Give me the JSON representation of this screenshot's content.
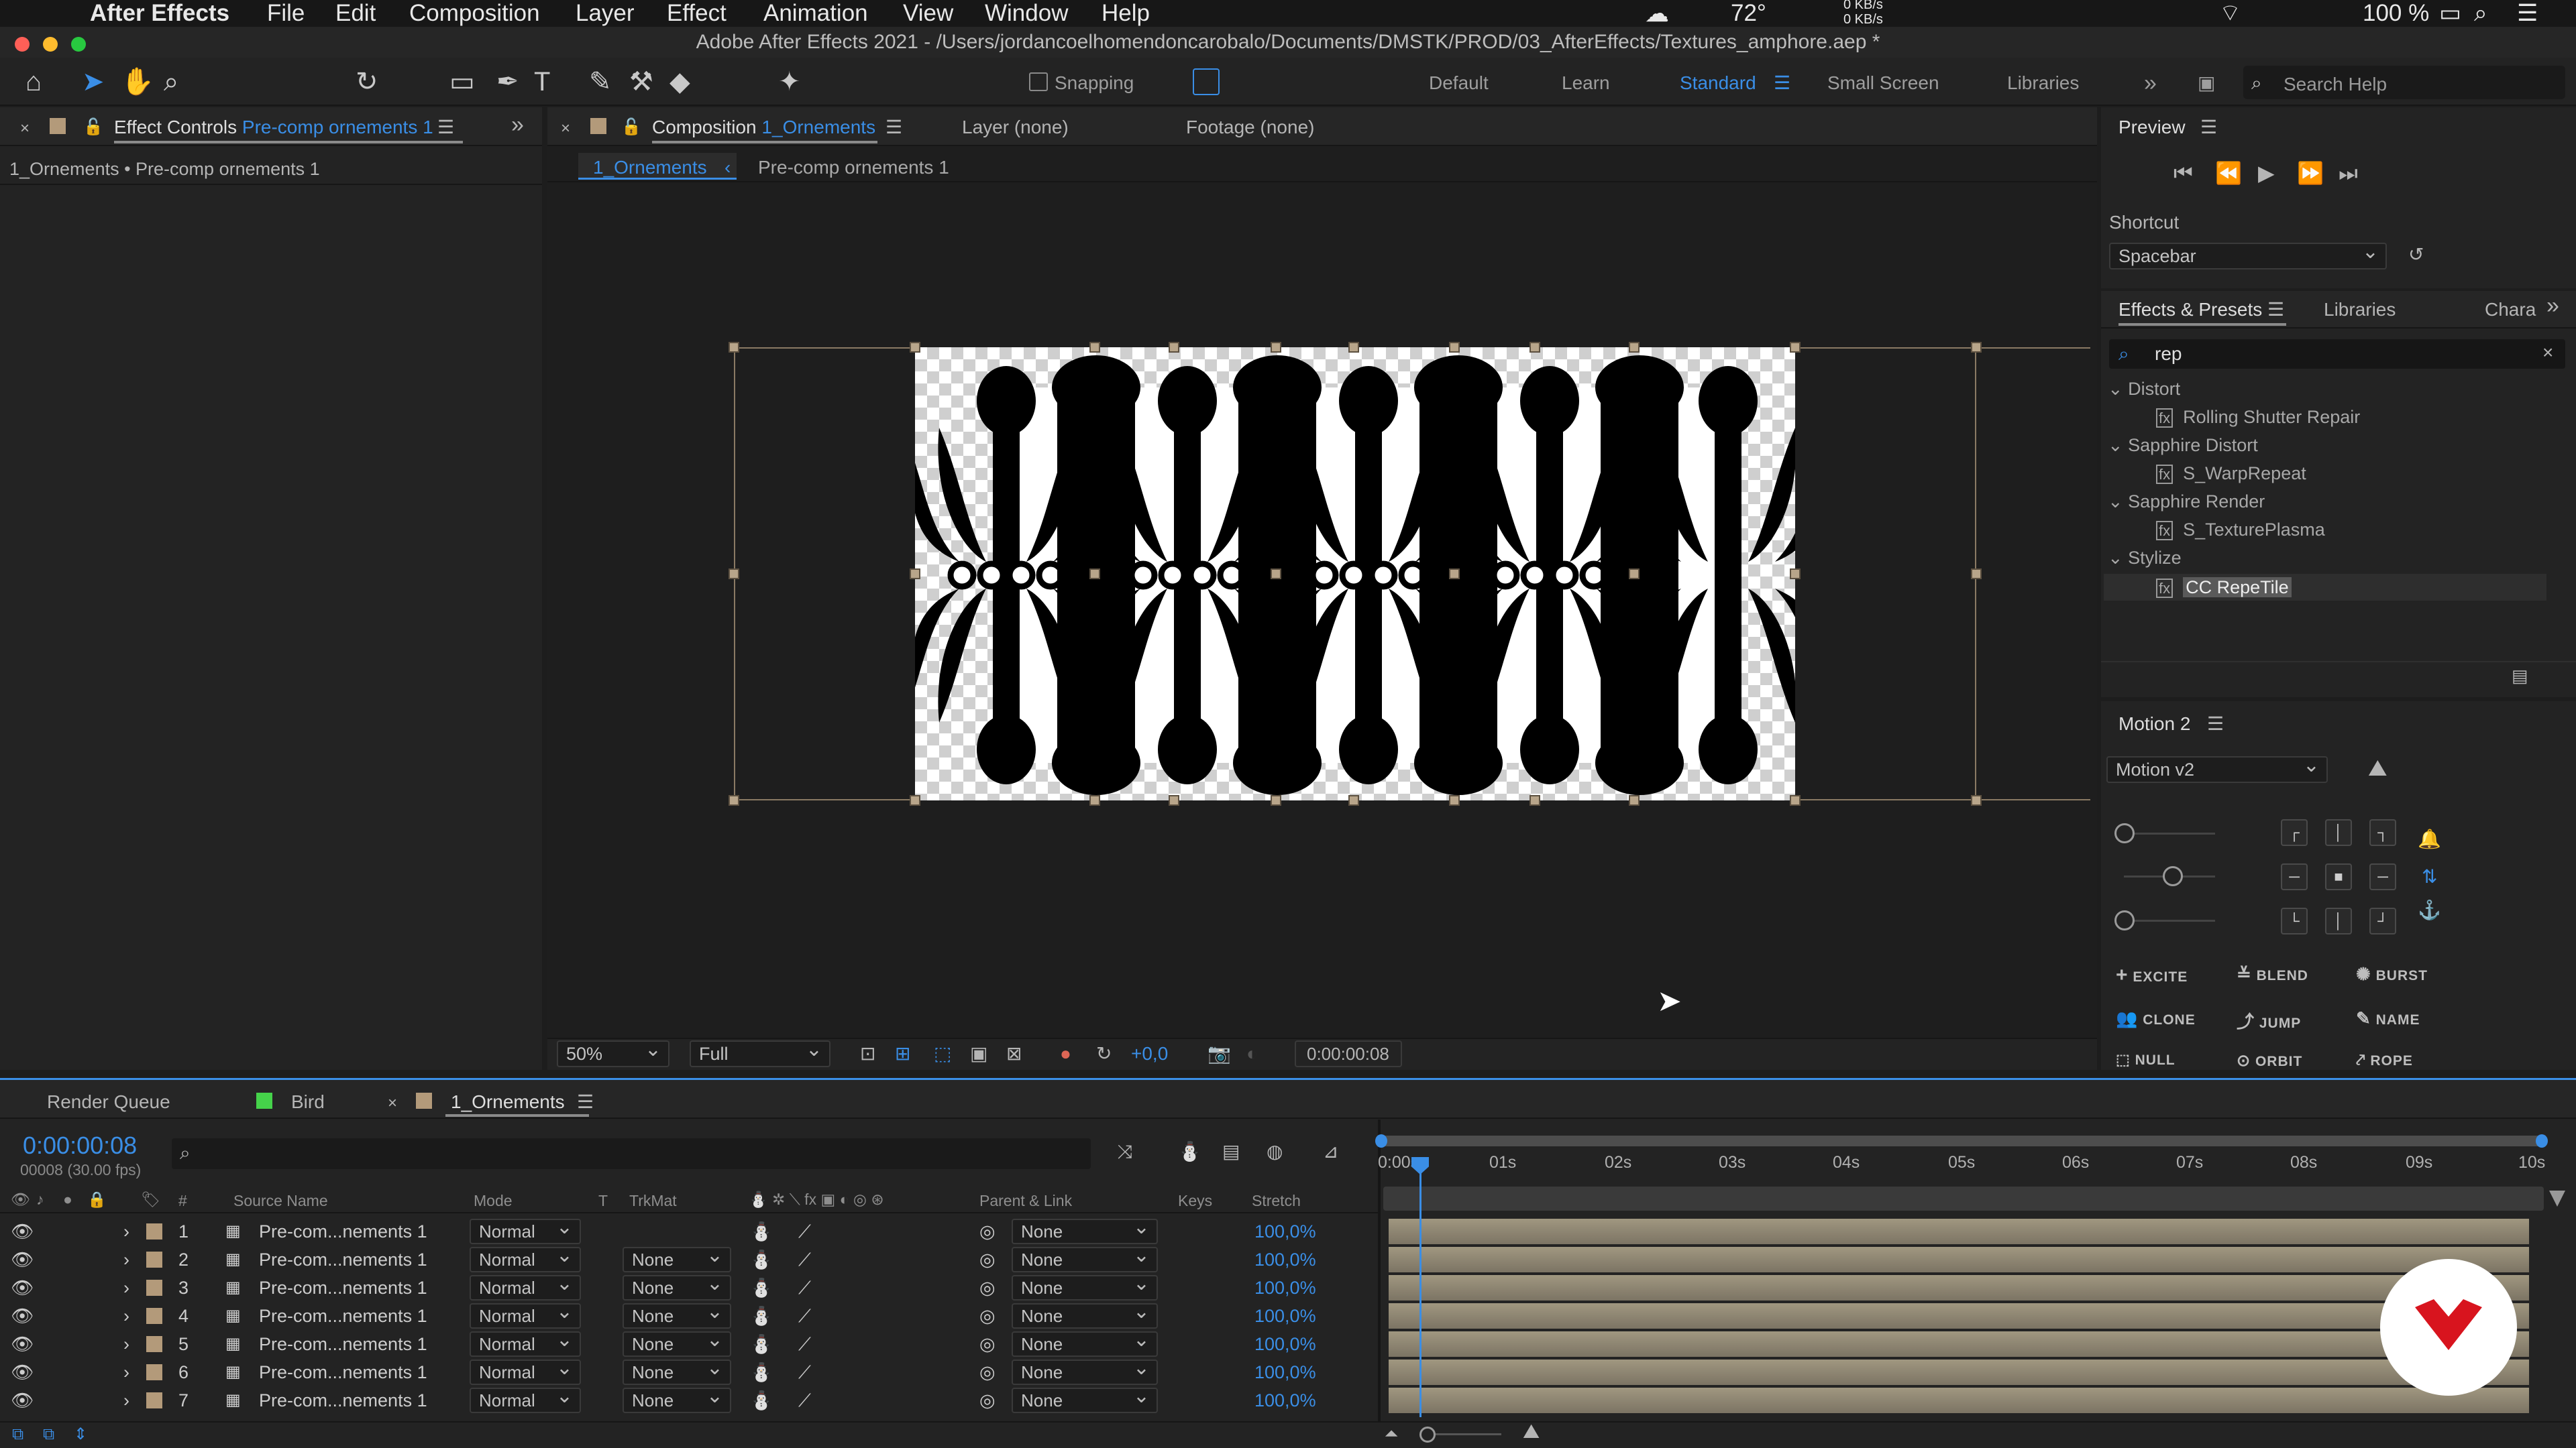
{
  "menubar": {
    "app": "After Effects",
    "items": [
      "File",
      "Edit",
      "Composition",
      "Layer",
      "Effect",
      "Animation",
      "View",
      "Window",
      "Help"
    ],
    "temp": "72°",
    "net_up": "0 KB/s",
    "net_down": "0 KB/s",
    "battery": "100 %"
  },
  "window": {
    "title": "Adobe After Effects 2021 - /Users/jordancoelhomendoncarobalo/Documents/DMSTK/PROD/03_AfterEffects/Textures_amphore.aep *"
  },
  "toolbar": {
    "snapping": "Snapping",
    "workspaces": [
      "Default",
      "Learn",
      "Standard",
      "Small Screen",
      "Libraries"
    ],
    "active_workspace": "Standard",
    "search_placeholder": "Search Help"
  },
  "effect_controls": {
    "tab_label": "Effect Controls",
    "tab_target": "Pre-comp ornements 1",
    "breadcrumb": "1_Ornements • Pre-comp ornements 1"
  },
  "composition": {
    "tab_label": "Composition",
    "tab_target": "1_Ornements",
    "layer_tab": "Layer (none)",
    "footage_tab": "Footage (none)",
    "crumb_active": "1_Ornements",
    "crumb_next": "Pre-comp ornements 1",
    "zoom": "50%",
    "resolution": "Full",
    "exposure": "+0,0",
    "timecode": "0:00:00:08"
  },
  "preview": {
    "title": "Preview",
    "shortcut_label": "Shortcut",
    "shortcut_value": "Spacebar"
  },
  "effects_presets": {
    "tab": "Effects & Presets",
    "tab2": "Libraries",
    "tab3": "Chara",
    "search": "rep",
    "groups": [
      {
        "name": "Distort",
        "items": [
          "Rolling Shutter Repair"
        ]
      },
      {
        "name": "Sapphire Distort",
        "items": [
          "S_WarpRepeat"
        ]
      },
      {
        "name": "Sapphire Render",
        "items": [
          "S_TexturePlasma"
        ]
      },
      {
        "name": "Stylize",
        "items": [
          "CC RepeTile"
        ]
      }
    ]
  },
  "motion": {
    "title": "Motion 2",
    "version": "Motion v2",
    "buttons": [
      "EXCITE",
      "BLEND",
      "BURST",
      "CLONE",
      "JUMP",
      "NAME",
      "NULL",
      "ORBIT",
      "ROPE"
    ]
  },
  "timeline": {
    "tabs": [
      "Render Queue",
      "Bird",
      "1_Ornements"
    ],
    "timecode": "0:00:00:08",
    "frame_info": "00008 (30.00 fps)",
    "columns": {
      "num": "#",
      "source": "Source Name",
      "mode": "Mode",
      "t": "T",
      "trkmat": "TrkMat",
      "parent": "Parent & Link",
      "keys": "Keys",
      "stretch": "Stretch"
    },
    "ruler": [
      "0:00s",
      "01s",
      "02s",
      "03s",
      "04s",
      "05s",
      "06s",
      "07s",
      "08s",
      "09s",
      "10s"
    ],
    "layers": [
      {
        "num": "1",
        "name": "Pre-com...nements 1",
        "mode": "Normal",
        "trkmat": "",
        "parent": "None",
        "stretch": "100,0%"
      },
      {
        "num": "2",
        "name": "Pre-com...nements 1",
        "mode": "Normal",
        "trkmat": "None",
        "parent": "None",
        "stretch": "100,0%"
      },
      {
        "num": "3",
        "name": "Pre-com...nements 1",
        "mode": "Normal",
        "trkmat": "None",
        "parent": "None",
        "stretch": "100,0%"
      },
      {
        "num": "4",
        "name": "Pre-com...nements 1",
        "mode": "Normal",
        "trkmat": "None",
        "parent": "None",
        "stretch": "100,0%"
      },
      {
        "num": "5",
        "name": "Pre-com...nements 1",
        "mode": "Normal",
        "trkmat": "None",
        "parent": "None",
        "stretch": "100,0%"
      },
      {
        "num": "6",
        "name": "Pre-com...nements 1",
        "mode": "Normal",
        "trkmat": "None",
        "parent": "None",
        "stretch": "100,0%"
      },
      {
        "num": "7",
        "name": "Pre-com...nements 1",
        "mode": "Normal",
        "trkmat": "None",
        "parent": "None",
        "stretch": "100,0%"
      }
    ]
  }
}
